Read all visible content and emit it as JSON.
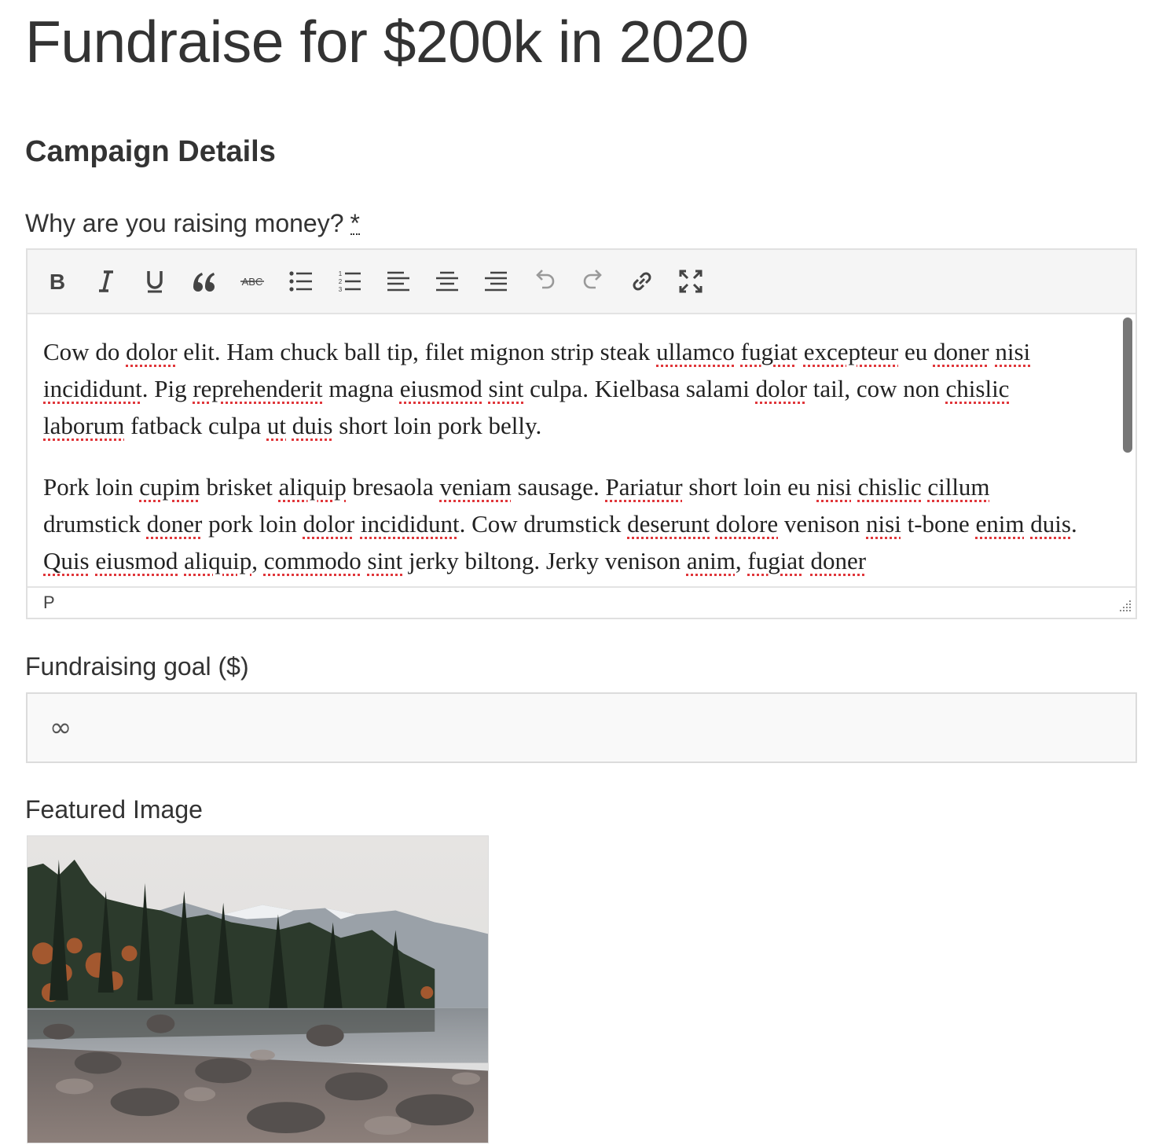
{
  "page": {
    "title": "Fundraise for $200k in 2020"
  },
  "section": {
    "title": "Campaign Details"
  },
  "why": {
    "label": "Why are you raising money?",
    "required_marker": "*",
    "toolbar": [
      {
        "name": "bold-button",
        "icon": "bold-icon"
      },
      {
        "name": "italic-button",
        "icon": "italic-icon"
      },
      {
        "name": "underline-button",
        "icon": "underline-icon"
      },
      {
        "name": "blockquote-button",
        "icon": "quote-icon"
      },
      {
        "name": "strikethrough-button",
        "icon": "strikethrough-icon"
      },
      {
        "name": "bullet-list-button",
        "icon": "bullet-list-icon"
      },
      {
        "name": "numbered-list-button",
        "icon": "numbered-list-icon"
      },
      {
        "name": "align-left-button",
        "icon": "align-left-icon"
      },
      {
        "name": "align-center-button",
        "icon": "align-center-icon"
      },
      {
        "name": "align-right-button",
        "icon": "align-right-icon"
      },
      {
        "name": "undo-button",
        "icon": "undo-icon"
      },
      {
        "name": "redo-button",
        "icon": "redo-icon"
      },
      {
        "name": "link-button",
        "icon": "link-icon"
      },
      {
        "name": "fullscreen-button",
        "icon": "fullscreen-icon"
      }
    ],
    "paragraph1": [
      [
        "Cow do ",
        false
      ],
      [
        "dolor",
        true
      ],
      [
        " elit. Ham chuck ball tip, filet mignon strip steak ",
        false
      ],
      [
        "ullamco",
        true
      ],
      [
        " ",
        false
      ],
      [
        "fugiat",
        true
      ],
      [
        " ",
        false
      ],
      [
        "excepteur",
        true
      ],
      [
        " eu ",
        false
      ],
      [
        "doner",
        true
      ],
      [
        " ",
        false
      ],
      [
        "nisi",
        true
      ],
      [
        " ",
        false
      ],
      [
        "incididunt",
        true
      ],
      [
        ". Pig ",
        false
      ],
      [
        "reprehenderit",
        true
      ],
      [
        " magna ",
        false
      ],
      [
        "eiusmod",
        true
      ],
      [
        " ",
        false
      ],
      [
        "sint",
        true
      ],
      [
        " culpa. Kielbasa salami ",
        false
      ],
      [
        "dolor",
        true
      ],
      [
        " tail, cow non ",
        false
      ],
      [
        "chislic",
        true
      ],
      [
        " ",
        false
      ],
      [
        "laborum",
        true
      ],
      [
        " fatback culpa ",
        false
      ],
      [
        "ut",
        true
      ],
      [
        " ",
        false
      ],
      [
        "duis",
        true
      ],
      [
        " short loin pork belly.",
        false
      ]
    ],
    "paragraph2": [
      [
        "Pork loin ",
        false
      ],
      [
        "cupim",
        true
      ],
      [
        " brisket ",
        false
      ],
      [
        "aliquip",
        true
      ],
      [
        " bresaola ",
        false
      ],
      [
        "veniam",
        true
      ],
      [
        " sausage. ",
        false
      ],
      [
        "Pariatur",
        true
      ],
      [
        " short loin eu ",
        false
      ],
      [
        "nisi",
        true
      ],
      [
        " ",
        false
      ],
      [
        "chislic",
        true
      ],
      [
        " ",
        false
      ],
      [
        "cillum",
        true
      ],
      [
        " drumstick ",
        false
      ],
      [
        "doner",
        true
      ],
      [
        " pork loin ",
        false
      ],
      [
        "dolor",
        true
      ],
      [
        " ",
        false
      ],
      [
        "incididunt",
        true
      ],
      [
        ". Cow drumstick ",
        false
      ],
      [
        "deserunt",
        true
      ],
      [
        " ",
        false
      ],
      [
        "dolore",
        true
      ],
      [
        " venison ",
        false
      ],
      [
        "nisi",
        true
      ],
      [
        " t-bone ",
        false
      ],
      [
        "enim",
        true
      ],
      [
        " ",
        false
      ],
      [
        "duis",
        true
      ],
      [
        ". ",
        false
      ],
      [
        "Quis",
        true
      ],
      [
        " ",
        false
      ],
      [
        "eiusmod",
        true
      ],
      [
        " ",
        false
      ],
      [
        "aliquip",
        true
      ],
      [
        ", ",
        false
      ],
      [
        "commodo",
        true
      ],
      [
        " ",
        false
      ],
      [
        "sint",
        true
      ],
      [
        " jerky biltong. Jerky venison ",
        false
      ],
      [
        "anim",
        true
      ],
      [
        ", ",
        false
      ],
      [
        "fugiat",
        true
      ],
      [
        " ",
        false
      ],
      [
        "doner",
        true
      ]
    ],
    "path": "P",
    "colors": {
      "spellcheck": "#e0363a",
      "scrollbar": "#777777"
    }
  },
  "goal": {
    "label": "Fundraising goal ($)",
    "value": "∞"
  },
  "featured": {
    "label": "Featured Image"
  }
}
